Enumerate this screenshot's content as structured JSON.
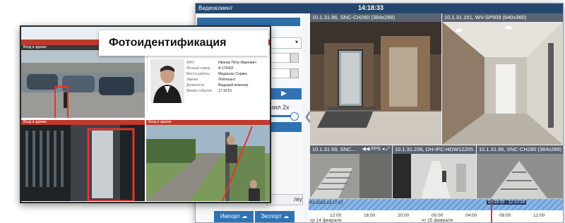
{
  "client": {
    "app_title": "Видеоклиент",
    "clock": "14:18:33",
    "sidebar": {
      "speed_label": "лнил 2х",
      "cleanup_label": "лку",
      "import_label": "Импорт",
      "export_label": "Экспорт"
    },
    "cameras": [
      {
        "id": "cam-main-1",
        "title": "10.1.31.96, SNC-CH260 (384x288)"
      },
      {
        "id": "cam-main-2",
        "title": "10.1.31.151, WV-SP509 (640x360)"
      },
      {
        "id": "cam-small-1",
        "title": "10.1.31.99, SNC...",
        "controls": "FPS"
      },
      {
        "id": "cam-small-2",
        "title": "10.1.31.236, DH-IPC-HDW12205..."
      },
      {
        "id": "cam-small-3",
        "title": "10.1.31.96, SNC-CH280 (384x288)"
      }
    ],
    "timeline": {
      "start_stamp": "02.2019 13:17:37",
      "selected_range": "10:19:33 - 12:10:24",
      "ticks": [
        "12:00",
        "16:00",
        "20:00",
        "00:00",
        "04:00",
        "08:00",
        "12:00"
      ],
      "days": [
        "ср 14 февраля",
        "чт 15 февраля"
      ]
    }
  },
  "photo_id": {
    "title": "Фотоидентификация",
    "subheader": "Вход в здание",
    "pane_labels": [
      "Вход в здание",
      "Вход в здание",
      "Вход в здание"
    ],
    "card_fields": [
      {
        "label": "ФИО",
        "value": "Иванов Пётр Иванович"
      },
      {
        "label": "Личный номер",
        "value": "А-176432"
      },
      {
        "label": "Место работы",
        "value": "Мидаскан Сервис"
      },
      {
        "label": "Звание",
        "value": "Лейтенант"
      },
      {
        "label": "Должность",
        "value": "Ведущий инженер"
      },
      {
        "label": "Время события",
        "value": "17:16:51"
      }
    ]
  },
  "colors": {
    "accent_blue": "#2f73b5",
    "title_bar": "#23476e",
    "alert_red": "#c0392b",
    "detection_box": "#e3342f"
  }
}
